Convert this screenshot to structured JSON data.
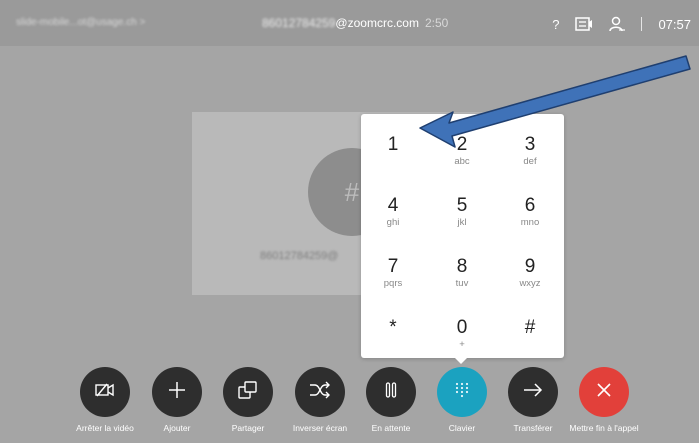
{
  "topbar": {
    "left_text": "slide-mobile...ot@usage.ch >",
    "number_blurred": "86012784259",
    "domain": "@zoomcrc.com",
    "call_timer": "2:50",
    "help": "?",
    "clock": "07:57"
  },
  "call": {
    "avatar_glyph": "#",
    "number": "86012784259@"
  },
  "dialpad": {
    "keys": [
      {
        "digit": "1",
        "letters": ""
      },
      {
        "digit": "2",
        "letters": "abc"
      },
      {
        "digit": "3",
        "letters": "def"
      },
      {
        "digit": "4",
        "letters": "ghi"
      },
      {
        "digit": "5",
        "letters": "jkl"
      },
      {
        "digit": "6",
        "letters": "mno"
      },
      {
        "digit": "7",
        "letters": "pqrs"
      },
      {
        "digit": "8",
        "letters": "tuv"
      },
      {
        "digit": "9",
        "letters": "wxyz"
      },
      {
        "digit": "*",
        "letters": ""
      },
      {
        "digit": "0",
        "letters": "+"
      },
      {
        "digit": "#",
        "letters": ""
      }
    ]
  },
  "controls": {
    "stop_video": "Arrêter la vidéo",
    "add": "Ajouter",
    "share": "Partager",
    "swap_screen": "Inverser écran",
    "hold": "En attente",
    "keypad": "Clavier",
    "transfer": "Transférer",
    "end_call": "Mettre fin à l'appel"
  },
  "colors": {
    "keypad_active": "#1ba2c0",
    "end_call": "#e2403a",
    "annotation_arrow": "#3f72b8"
  }
}
